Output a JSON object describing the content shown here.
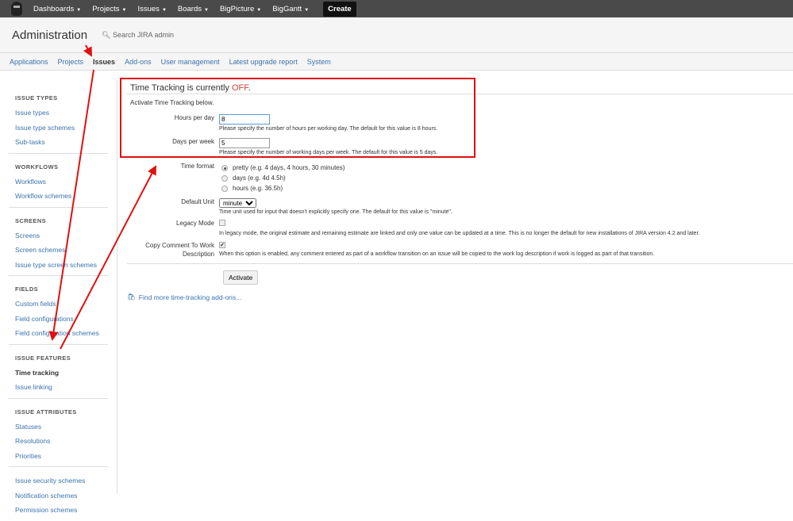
{
  "topnav": {
    "items": [
      "Dashboards",
      "Projects",
      "Issues",
      "Boards",
      "BigPicture",
      "BigGantt"
    ],
    "create": "Create"
  },
  "header": {
    "title": "Administration",
    "search_placeholder": "Search JIRA admin"
  },
  "tabs": [
    "Applications",
    "Projects",
    "Issues",
    "Add-ons",
    "User management",
    "Latest upgrade report",
    "System"
  ],
  "sidebar": [
    {
      "heading": "ISSUE TYPES",
      "items": [
        "Issue types",
        "Issue type schemes",
        "Sub-tasks"
      ]
    },
    {
      "heading": "WORKFLOWS",
      "items": [
        "Workflows",
        "Workflow schemes"
      ]
    },
    {
      "heading": "SCREENS",
      "items": [
        "Screens",
        "Screen schemes",
        "Issue type screen schemes"
      ]
    },
    {
      "heading": "FIELDS",
      "items": [
        "Custom fields",
        "Field configurations",
        "Field configuration schemes"
      ]
    },
    {
      "heading": "ISSUE FEATURES",
      "items": [
        "Time tracking",
        "Issue linking"
      ]
    },
    {
      "heading": "ISSUE ATTRIBUTES",
      "items": [
        "Statuses",
        "Resolutions",
        "Priorities"
      ]
    },
    {
      "heading": "",
      "items": [
        "Issue security schemes",
        "Notification schemes",
        "Permission schemes"
      ]
    }
  ],
  "main": {
    "title_prefix": "Time Tracking is currently ",
    "title_status": "OFF",
    "title_suffix": ".",
    "activate_text": "Activate Time Tracking below.",
    "hours_label": "Hours per day",
    "hours_value": "8",
    "hours_desc": "Please specify the number of hours per working day. The default for this value is 8 hours.",
    "days_label": "Days per week",
    "days_value": "5",
    "days_desc": "Please specify the number of working days per week. The default for this value is 5 days.",
    "format_label": "Time format",
    "formats": [
      "pretty (e.g. 4 days, 4 hours, 30 minutes)",
      "days (e.g. 4d 4.5h)",
      "hours (e.g. 36.5h)"
    ],
    "unit_label": "Default Unit",
    "unit_value": "minute",
    "unit_desc": "Time unit used for input that doesn't explicitly specify one. The default for this value is \"minute\".",
    "legacy_label": "Legacy Mode",
    "legacy_desc": "In legacy mode, the original estimate and remaining estimate are linked and only one value can be updated at a time. This is no longer the default for new installations of JIRA version 4.2 and later.",
    "copy_label": "Copy Comment To Work Description",
    "copy_desc": "When this option is enabled, any comment entered as part of a workflow transition on an issue will be copied to the work log description if work is logged as part of that transition.",
    "activate_button": "Activate",
    "more_link": "Find more time-tracking add-ons..."
  },
  "colors": {
    "accent": "#3b73af",
    "off": "#d04437",
    "annotation": "#e01010"
  }
}
